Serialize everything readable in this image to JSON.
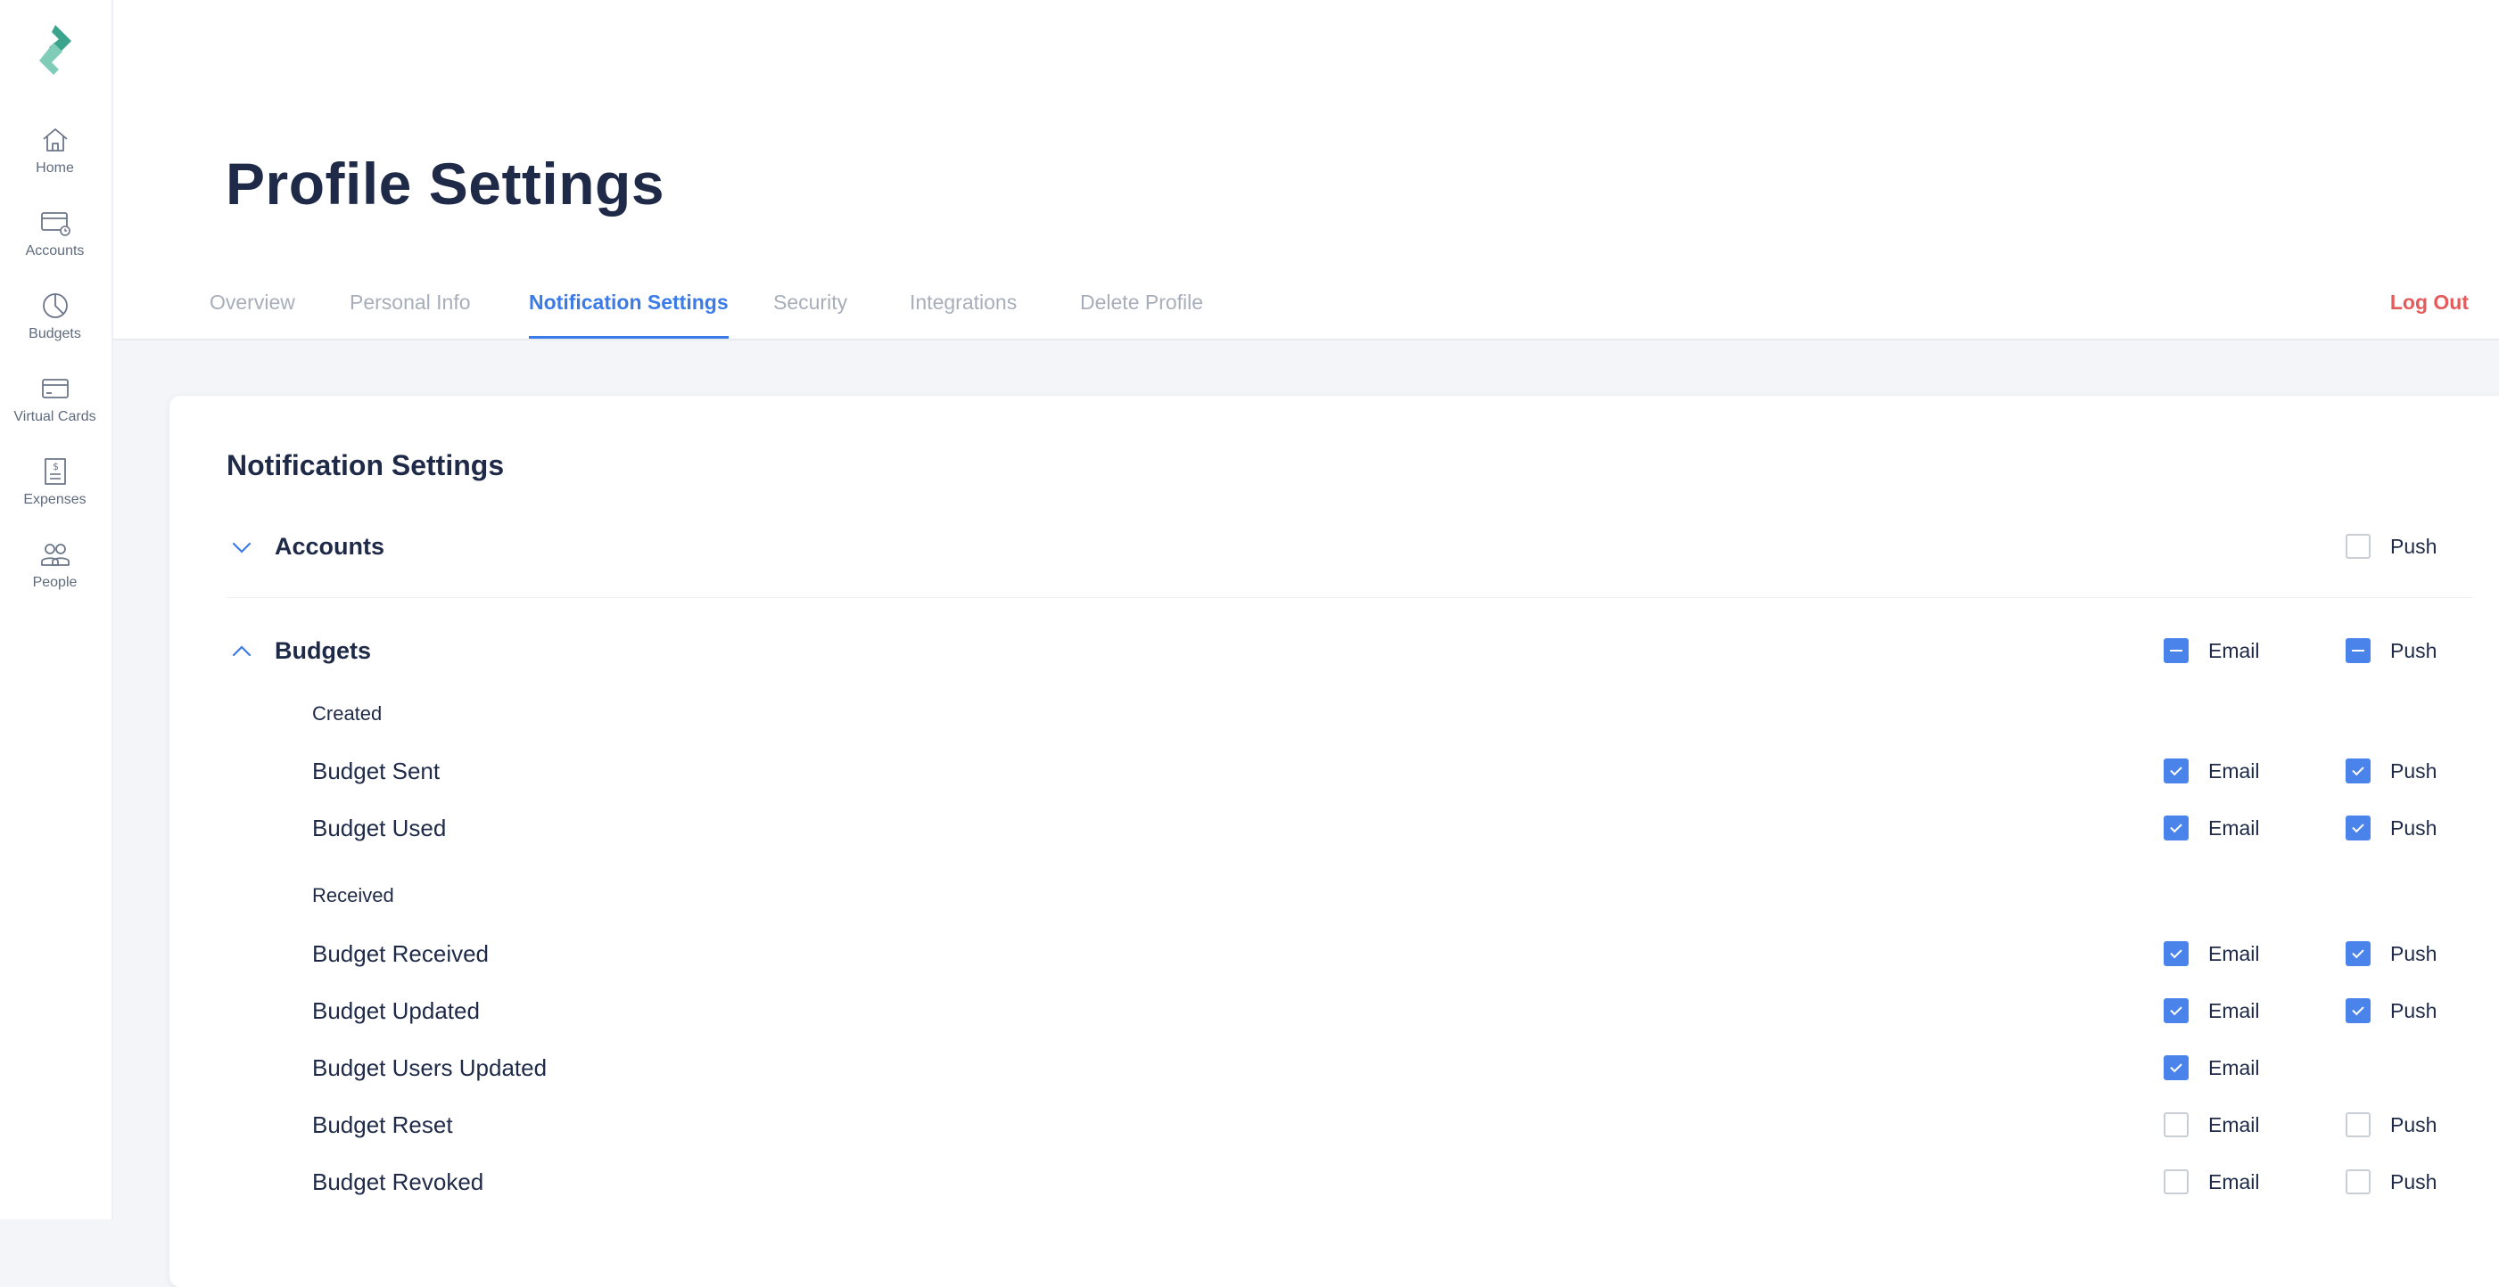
{
  "colors": {
    "accent": "#3b7be8",
    "checkbox": "#4a84ea",
    "logout": "#e35b5b",
    "logo": "#3aa48d"
  },
  "sidebar": {
    "items": [
      {
        "label": "Home",
        "icon": "home-icon"
      },
      {
        "label": "Accounts",
        "icon": "accounts-icon"
      },
      {
        "label": "Budgets",
        "icon": "budgets-pie-icon"
      },
      {
        "label": "Virtual Cards",
        "icon": "card-icon"
      },
      {
        "label": "Expenses",
        "icon": "receipt-icon"
      },
      {
        "label": "People",
        "icon": "people-icon"
      }
    ]
  },
  "header": {
    "title": "Profile Settings",
    "tabs": [
      {
        "label": "Overview",
        "active": false
      },
      {
        "label": "Personal Info",
        "active": false
      },
      {
        "label": "Notification Settings",
        "active": true
      },
      {
        "label": "Security",
        "active": false
      },
      {
        "label": "Integrations",
        "active": false
      },
      {
        "label": "Delete Profile",
        "active": false
      }
    ],
    "logout_label": "Log Out"
  },
  "notifications": {
    "title": "Notification Settings",
    "email_label": "Email",
    "push_label": "Push",
    "groups": {
      "accounts": {
        "name": "Accounts",
        "expanded": false,
        "push": "unchecked"
      },
      "budgets": {
        "name": "Budgets",
        "expanded": true,
        "email": "partial",
        "push": "partial",
        "sections": {
          "created": {
            "label": "Created",
            "items": [
              {
                "name": "Budget Sent",
                "email": "checked",
                "push": "checked"
              },
              {
                "name": "Budget Used",
                "email": "checked",
                "push": "checked"
              }
            ]
          },
          "received": {
            "label": "Received",
            "items": [
              {
                "name": "Budget Received",
                "email": "checked",
                "push": "checked"
              },
              {
                "name": "Budget Updated",
                "email": "checked",
                "push": "checked"
              },
              {
                "name": "Budget Users Updated",
                "email": "checked"
              },
              {
                "name": "Budget Reset",
                "email": "unchecked",
                "push": "unchecked"
              },
              {
                "name": "Budget Revoked",
                "email": "unchecked",
                "push": "unchecked"
              }
            ]
          }
        }
      }
    }
  }
}
